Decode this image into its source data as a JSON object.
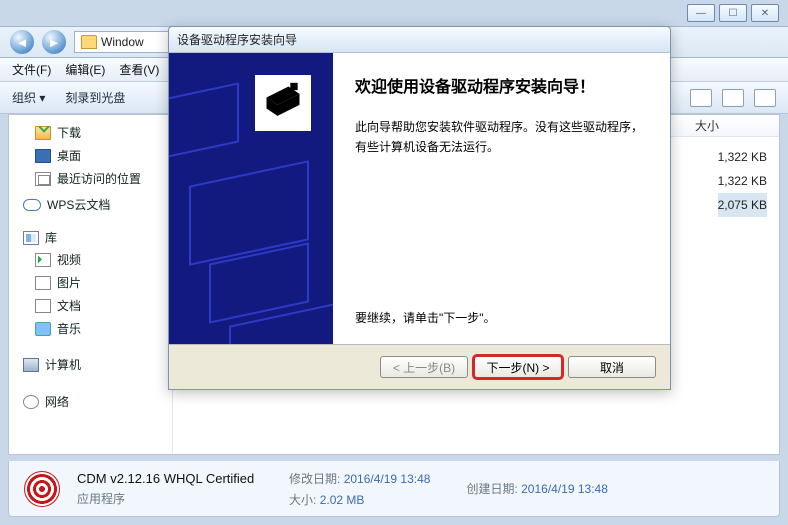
{
  "window_controls": {
    "min": "—",
    "max": "☐",
    "close": "✕"
  },
  "address": {
    "label": "Window"
  },
  "menu": {
    "file": "文件(F)",
    "edit": "编辑(E)",
    "view": "查看(V)"
  },
  "toolbar": {
    "organize": "组织 ▾",
    "burn": "刻录到光盘"
  },
  "tree": {
    "downloads": "下载",
    "desktop": "桌面",
    "recent": "最近访问的位置",
    "wps": "WPS云文档",
    "library": "库",
    "video": "视频",
    "pictures": "图片",
    "documents": "文档",
    "music": "音乐",
    "computer": "计算机",
    "network": "网络"
  },
  "column_size": "大小",
  "files": [
    {
      "size": "1,322 KB"
    },
    {
      "size": "1,322 KB"
    },
    {
      "size": "2,075 KB"
    }
  ],
  "details": {
    "name": "CDM v2.12.16 WHQL Certified",
    "type": "应用程序",
    "mod_label": "修改日期:",
    "mod_value": "2016/4/19 13:48",
    "size_label": "大小:",
    "size_value": "2.02 MB",
    "create_label": "创建日期:",
    "create_value": "2016/4/19 13:48"
  },
  "wizard": {
    "title": "设备驱动程序安装向导",
    "heading": "欢迎使用设备驱动程序安装向导！",
    "para1": "此向导帮助您安装软件驱动程序。没有这些驱动程序，有些计算机设备无法运行。",
    "prompt": "要继续，请单击\"下一步\"。",
    "back": "< 上一步(B)",
    "next": "下一步(N) >",
    "cancel": "取消"
  }
}
